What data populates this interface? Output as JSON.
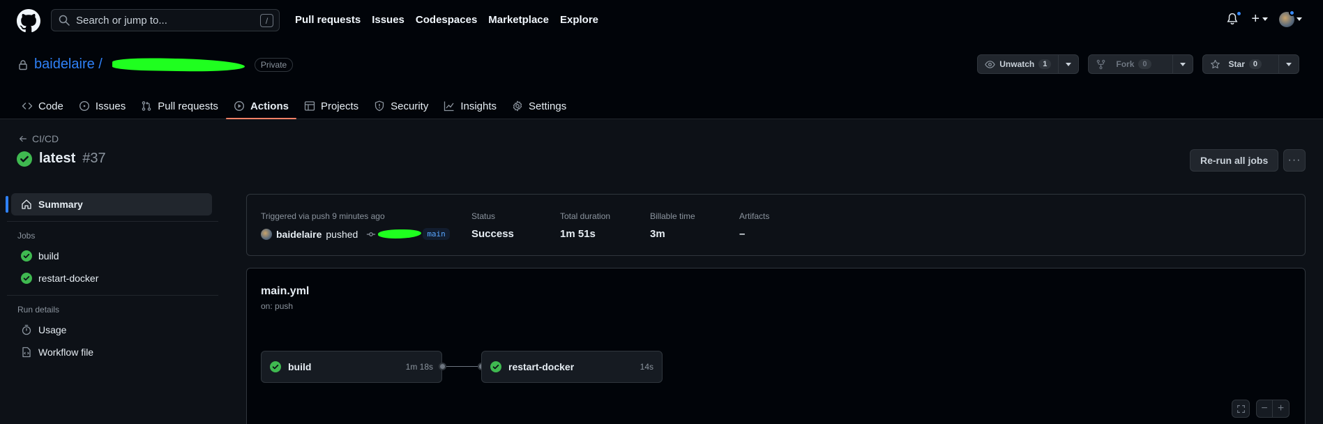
{
  "header": {
    "search_placeholder": "Search or jump to...",
    "search_key": "/",
    "nav": [
      "Pull requests",
      "Issues",
      "Codespaces",
      "Marketplace",
      "Explore"
    ],
    "plus": "+"
  },
  "repo": {
    "owner": "baidelaire",
    "separator": "/",
    "visibility": "Private",
    "watch": {
      "label": "Unwatch",
      "count": "1"
    },
    "fork": {
      "label": "Fork",
      "count": "0"
    },
    "star": {
      "label": "Star",
      "count": "0"
    }
  },
  "tabs": [
    {
      "label": "Code",
      "icon": "code-icon"
    },
    {
      "label": "Issues",
      "icon": "issue-icon"
    },
    {
      "label": "Pull requests",
      "icon": "pull-request-icon"
    },
    {
      "label": "Actions",
      "icon": "play-icon",
      "active": true
    },
    {
      "label": "Projects",
      "icon": "table-icon"
    },
    {
      "label": "Security",
      "icon": "shield-icon"
    },
    {
      "label": "Insights",
      "icon": "graph-icon"
    },
    {
      "label": "Settings",
      "icon": "gear-icon"
    }
  ],
  "run": {
    "back_label": "CI/CD",
    "name": "latest",
    "number": "#37",
    "rerun_label": "Re-run all jobs",
    "more_label": "···"
  },
  "sidebar": {
    "summary": "Summary",
    "jobs_heading": "Jobs",
    "jobs": [
      "build",
      "restart-docker"
    ],
    "details_heading": "Run details",
    "usage": "Usage",
    "workflow_file": "Workflow file"
  },
  "summary": {
    "triggered": "Triggered via push 9 minutes ago",
    "user": "baidelaire",
    "action": "pushed",
    "branch": "main",
    "status_label": "Status",
    "status_value": "Success",
    "duration_label": "Total duration",
    "duration_value": "1m 51s",
    "billable_label": "Billable time",
    "billable_value": "3m",
    "artifacts_label": "Artifacts",
    "artifacts_value": "–"
  },
  "workflow": {
    "file": "main.yml",
    "trigger": "on: push",
    "jobs": [
      {
        "name": "build",
        "duration": "1m 18s"
      },
      {
        "name": "restart-docker",
        "duration": "14s"
      }
    ],
    "zoom_out": "−",
    "zoom_in": "+"
  },
  "colors": {
    "accent": "#2f81f7",
    "success": "#3fb950",
    "tab_underline": "#f78166"
  }
}
